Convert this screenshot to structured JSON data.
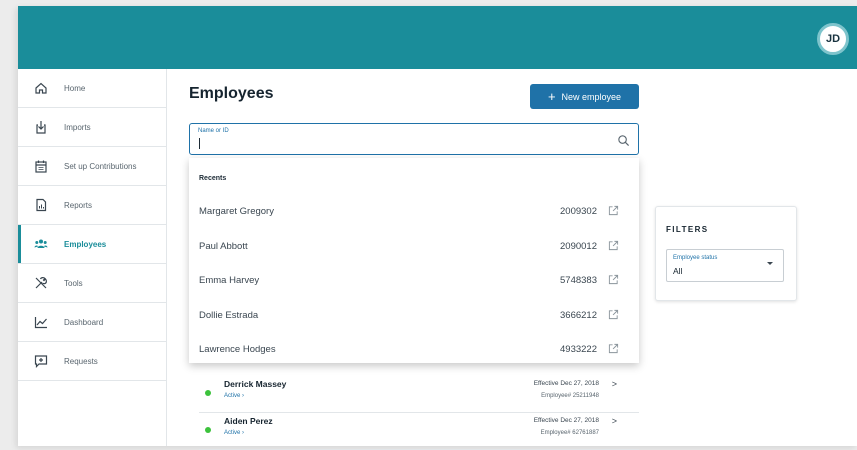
{
  "header": {
    "avatar_initials": "JD"
  },
  "sidebar": {
    "items": [
      {
        "label": "Home",
        "icon": "home-icon"
      },
      {
        "label": "Imports",
        "icon": "import-icon"
      },
      {
        "label": "Set up Contributions",
        "icon": "calendar-icon"
      },
      {
        "label": "Reports",
        "icon": "report-icon"
      },
      {
        "label": "Employees",
        "icon": "people-icon",
        "active": true
      },
      {
        "label": "Tools",
        "icon": "tools-icon"
      },
      {
        "label": "Dashboard",
        "icon": "chart-icon"
      },
      {
        "label": "Requests",
        "icon": "request-icon"
      }
    ]
  },
  "main": {
    "title": "Employees",
    "new_button_label": "New employee",
    "search": {
      "label": "Name or ID",
      "value": ""
    },
    "recents": {
      "heading": "Recents",
      "items": [
        {
          "name": "Margaret Gregory",
          "id": "2009302"
        },
        {
          "name": "Paul Abbott",
          "id": "2090012"
        },
        {
          "name": "Emma Harvey",
          "id": "5748383"
        },
        {
          "name": "Dollie Estrada",
          "id": "3666212"
        },
        {
          "name": "Lawrence Hodges",
          "id": "4933222"
        }
      ]
    },
    "employees": [
      {
        "name": "Derrick Massey",
        "status": "Active ›",
        "effective": "Effective Dec 27, 2018",
        "employee_number": "Employee# 25211948"
      },
      {
        "name": "Aiden Perez",
        "status": "Active ›",
        "effective": "Effective Dec 27, 2018",
        "employee_number": "Employee# 62761887"
      }
    ]
  },
  "filters": {
    "title": "FILTERS",
    "employee_status": {
      "label": "Employee status",
      "value": "All"
    }
  },
  "colors": {
    "topbar": "#1a8d9a",
    "accent": "#1f72a8",
    "active_dot": "#3cc23c"
  }
}
